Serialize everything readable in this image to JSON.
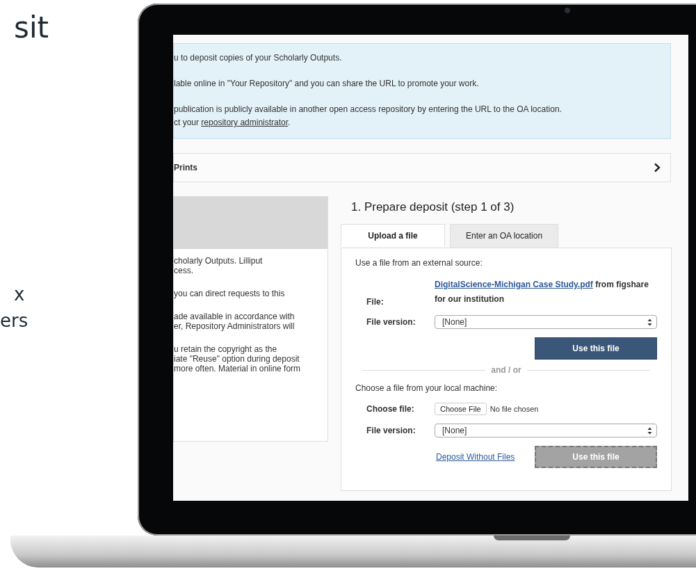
{
  "side_text": {
    "heading": "sit",
    "lines": [
      "x",
      "ers"
    ]
  },
  "info": {
    "paragraphs": [
      "u to deposit copies of your Scholarly Outputs.",
      "lable online in \"Your Repository\" and you can share the URL to promote your work.",
      "publication is publicly available in another open access repository by entering the URL to the OA location."
    ],
    "contact": {
      "prefix": "ct your ",
      "link": "repository administrator",
      "suffix": "."
    }
  },
  "accordion": {
    "title": "Prints",
    "expanded": false
  },
  "left_panel": {
    "paragraphs": [
      "cholarly Outputs. Lilliput\ncess.",
      "you can direct requests to this",
      "ade available in accordance with\ner, Repository Administrators will",
      "u retain the copyright as the\niate \"Reuse\" option during deposit\nmore often. Material in online form"
    ]
  },
  "deposit": {
    "heading": "1. Prepare deposit (step 1 of 3)",
    "tabs": [
      {
        "label": "Upload a file",
        "selected": true
      },
      {
        "label": "Enter an OA location",
        "selected": false
      }
    ],
    "external": {
      "intro": "Use a file from an external source:",
      "file_label": "File:",
      "file_link": "DigitalScience-Michigan Case Study.pdf",
      "file_source": " from figshare for our institution",
      "version_label": "File version:",
      "version_value": "[None]",
      "button": {
        "label": "Use this file",
        "disabled": false
      }
    },
    "separator": "and / or",
    "local": {
      "intro": "Choose a file from your local machine:",
      "choose_label": "Choose file:",
      "choose_button": "Choose File",
      "choose_status": "No file chosen",
      "version_label": "File version:",
      "version_value": "[None]",
      "link": "Deposit Without Files",
      "button": {
        "label": "Use this file",
        "disabled": true
      }
    }
  }
}
